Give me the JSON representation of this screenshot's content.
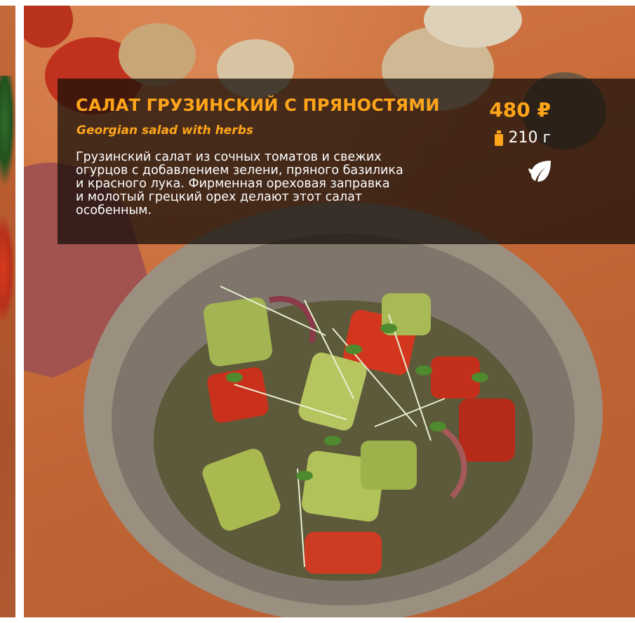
{
  "colors": {
    "accent": "#ffa51a",
    "text_light": "#ffffff",
    "panel_overlay": "rgba(20,14,10,0.74)"
  },
  "dish": {
    "title_ru": "САЛАТ ГРУЗИНСКИЙ С ПРЯНОСТЯМИ",
    "title_en": "Georgian salad with herbs",
    "description_lines": [
      "Грузинский салат из сочных томатов и свежих",
      "огурцов с добавлением зелени, пряного базилика",
      "и красного лука. Фирменная ореховая заправка",
      "и молотый грецкий орех делают этот салат",
      "особенным."
    ],
    "price": "480 ₽",
    "weight": "210 г",
    "weight_icon": "weight-icon",
    "diet_icon": "leaf-icon"
  }
}
